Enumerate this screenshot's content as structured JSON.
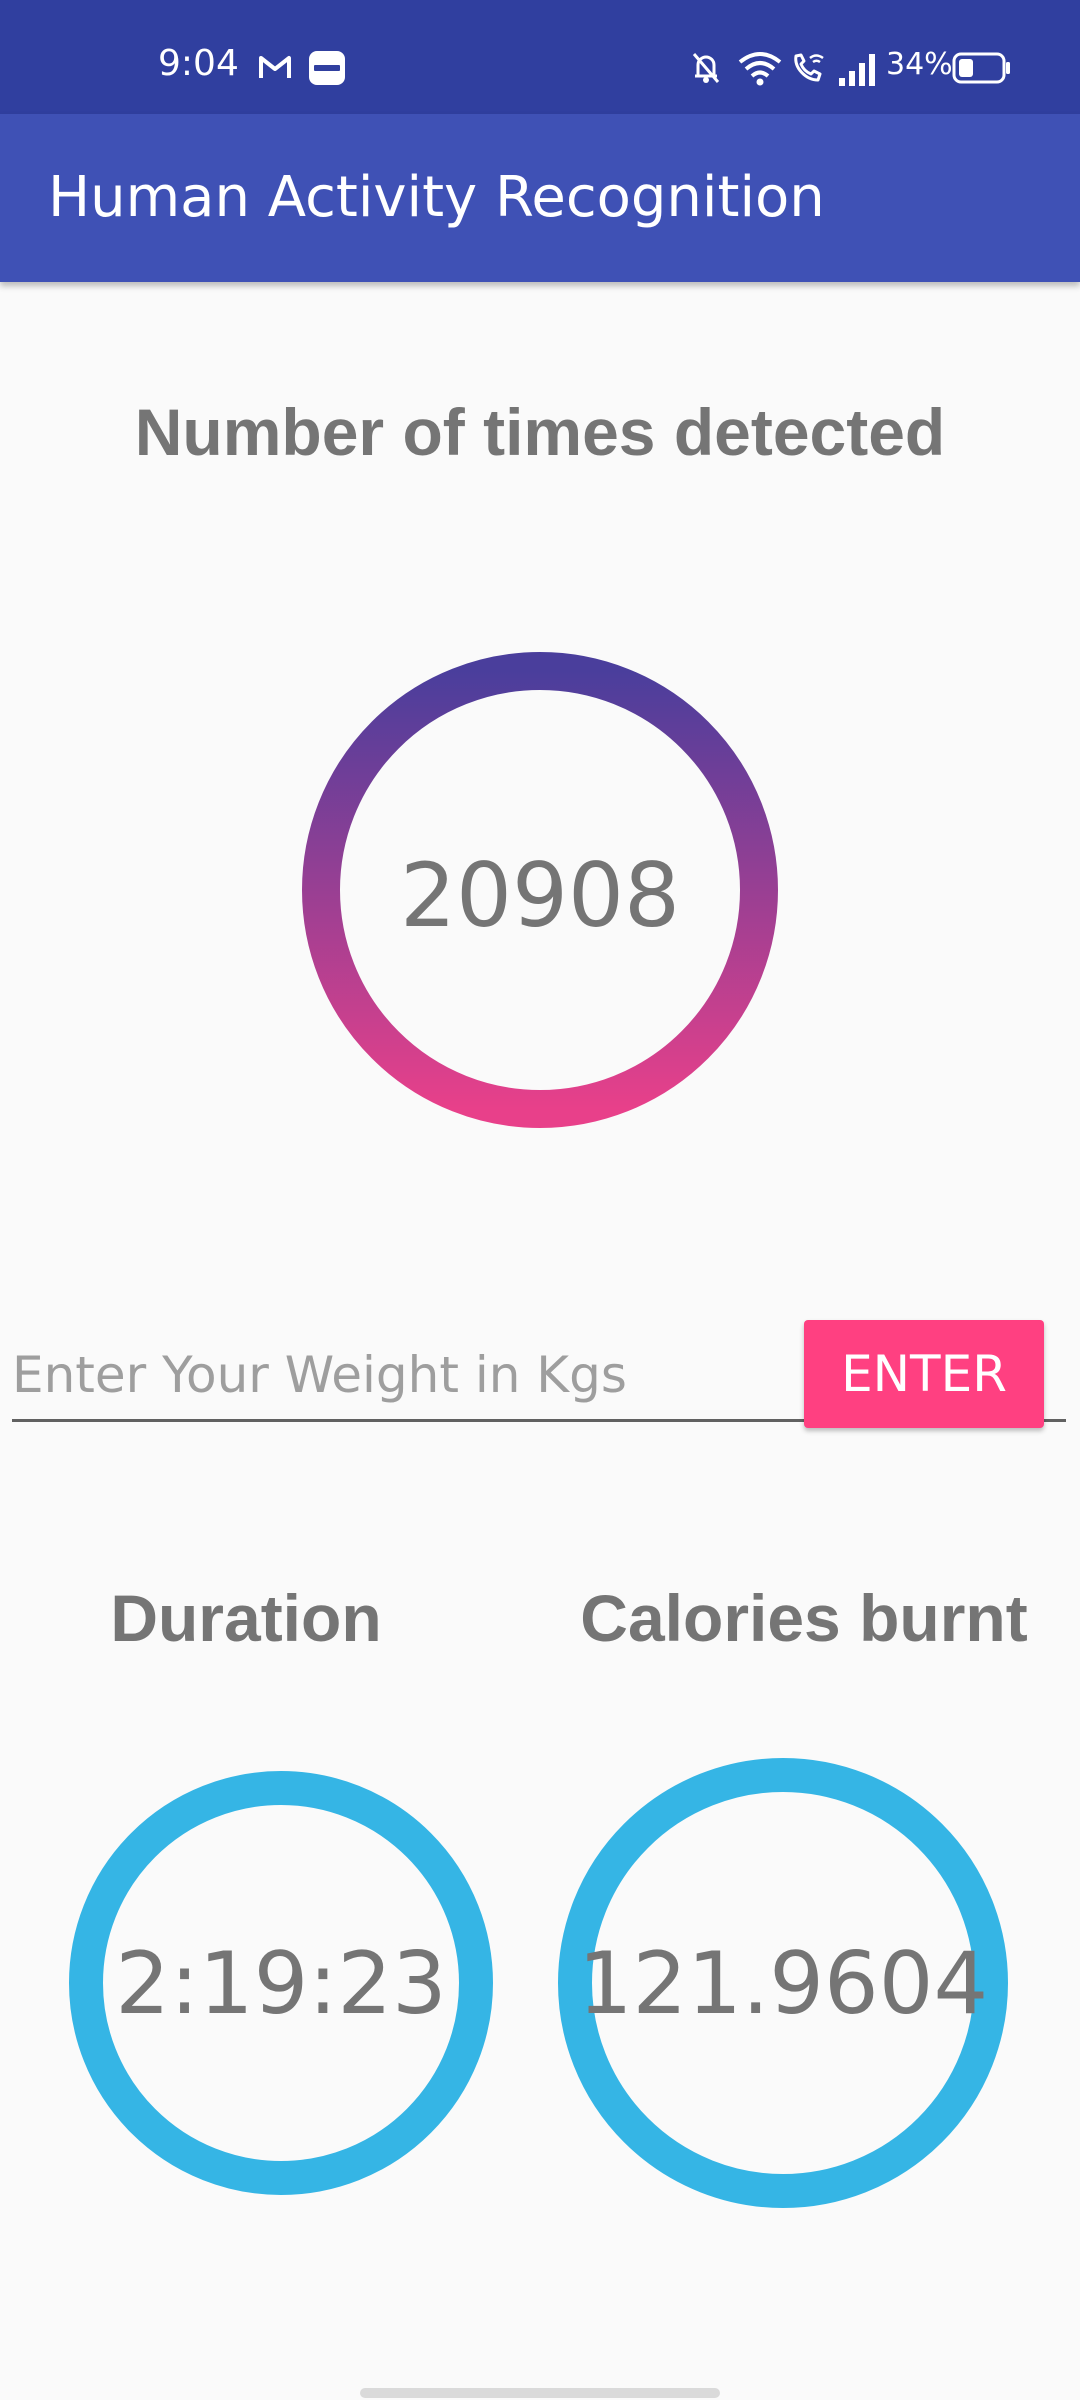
{
  "status_bar": {
    "time": "9:04",
    "battery_percent": "34%",
    "battery_level": 0.34,
    "icons": [
      "gmail-icon",
      "paytm-icon",
      "mute-icon",
      "wifi-icon",
      "wifi-call-icon",
      "signal-icon",
      "battery-icon"
    ]
  },
  "app_bar": {
    "title": "Human Activity Recognition"
  },
  "detection": {
    "heading": "Number of times detected",
    "count": "20908"
  },
  "weight": {
    "placeholder": "Enter Your Weight in Kgs",
    "value": "",
    "button_label": "ENTER"
  },
  "duration": {
    "heading": "Duration",
    "value": "2:19:23"
  },
  "calories": {
    "heading": "Calories burnt",
    "value": "121.9604"
  },
  "colors": {
    "status_bar": "#303F9F",
    "app_bar": "#3F51B5",
    "accent": "#FF4081",
    "ring_blue": "#35B5E5",
    "ring_gradient_top": "#4A3E9C",
    "ring_gradient_bottom": "#E8408A",
    "text_gray": "#757575"
  }
}
